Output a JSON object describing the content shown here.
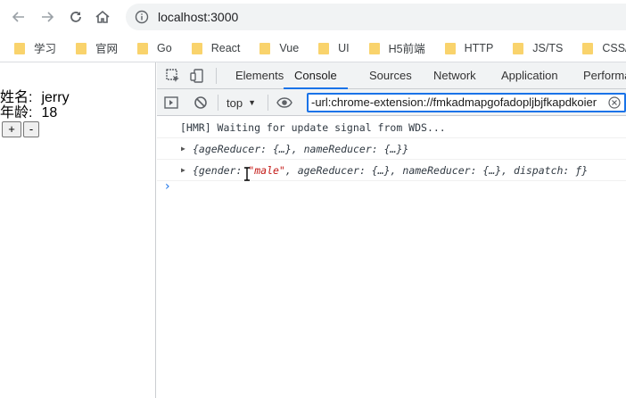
{
  "browser": {
    "url": "localhost:3000",
    "bookmarks": [
      "学习",
      "官网",
      "Go",
      "React",
      "Vue",
      "UI",
      "H5前端",
      "HTTP",
      "JS/TS",
      "CSS/Less/Sa"
    ]
  },
  "page": {
    "name_label": "姓名:",
    "name_value": "jerry",
    "age_label": "年龄:",
    "age_value": "18",
    "plus_label": "+",
    "minus_label": "-"
  },
  "devtools": {
    "tabs": [
      "Elements",
      "Console",
      "Sources",
      "Network",
      "Application",
      "Performa"
    ],
    "active_tab": "Console",
    "context": "top",
    "filter_value": "-url:chrome-extension://fmkadmapgofadopljbjfkapdkoier",
    "messages": {
      "hmr": "[HMR] Waiting for update signal from WDS...",
      "obj1": "{ageReducer: {…}, nameReducer: {…}}",
      "obj2_prefix": "{gender: ",
      "obj2_str": "\"male\"",
      "obj2_suffix": ", ageReducer: {…}, nameReducer: {…}, dispatch: ƒ}"
    },
    "prompt": "›"
  },
  "colors": {
    "accent": "#1a73e8",
    "folder": "#f9d36c",
    "string": "#c41a16"
  }
}
